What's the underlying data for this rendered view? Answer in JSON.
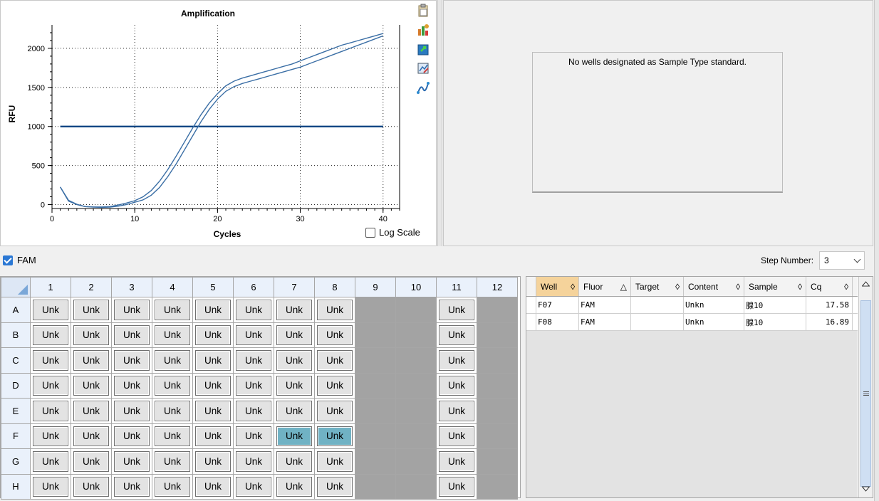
{
  "chart": {
    "title": "Amplification",
    "xlabel": "Cycles",
    "ylabel": "RFU",
    "log_scale_label": "Log Scale",
    "log_scale_checked": false
  },
  "chart_data": {
    "type": "line",
    "title": "Amplification",
    "xlabel": "Cycles",
    "ylabel": "RFU",
    "xlim": [
      0,
      42
    ],
    "ylim": [
      -50,
      2300
    ],
    "xticks": [
      0,
      10,
      20,
      30,
      40
    ],
    "yticks": [
      0,
      500,
      1000,
      1500,
      2000
    ],
    "grid": true,
    "threshold": 1000,
    "threshold_color": "#003f7f",
    "series_color": "#3a6ea5",
    "x": [
      1,
      2,
      3,
      4,
      5,
      6,
      7,
      8,
      9,
      10,
      11,
      12,
      13,
      14,
      15,
      16,
      17,
      18,
      19,
      20,
      21,
      22,
      23,
      24,
      25,
      26,
      27,
      28,
      29,
      30,
      31,
      32,
      33,
      34,
      35,
      36,
      37,
      38,
      39,
      40
    ],
    "series": [
      {
        "values": [
          225,
          55,
          5,
          -25,
          -30,
          -30,
          -25,
          -5,
          20,
          50,
          100,
          180,
          300,
          450,
          620,
          800,
          980,
          1150,
          1300,
          1420,
          1520,
          1580,
          1620,
          1650,
          1680,
          1710,
          1740,
          1770,
          1800,
          1840,
          1880,
          1920,
          1960,
          2000,
          2040,
          2070,
          2100,
          2130,
          2160,
          2190
        ]
      },
      {
        "values": [
          225,
          45,
          0,
          -25,
          -32,
          -35,
          -32,
          -20,
          0,
          30,
          60,
          120,
          220,
          360,
          520,
          700,
          880,
          1060,
          1220,
          1350,
          1450,
          1510,
          1550,
          1580,
          1610,
          1640,
          1670,
          1700,
          1730,
          1760,
          1800,
          1840,
          1880,
          1920,
          1960,
          2000,
          2040,
          2080,
          2120,
          2160
        ]
      }
    ]
  },
  "icons": [
    "clipboard-icon",
    "export-chart-icon",
    "export-data-icon",
    "chart-tools-icon",
    "trace-icon"
  ],
  "standard_message": "No wells designated as Sample Type standard.",
  "fluor_checkbox": {
    "label": "FAM",
    "checked": true
  },
  "step": {
    "label": "Step Number:",
    "value": "3"
  },
  "plate": {
    "columns": [
      "1",
      "2",
      "3",
      "4",
      "5",
      "6",
      "7",
      "8",
      "9",
      "10",
      "11",
      "12"
    ],
    "rows": [
      "A",
      "B",
      "C",
      "D",
      "E",
      "F",
      "G",
      "H"
    ],
    "well_label": "Unk",
    "empty_columns": [
      "9",
      "10",
      "12"
    ],
    "selected_wells": [
      "F7",
      "F8"
    ]
  },
  "results": {
    "headers": [
      "Well",
      "Fluor",
      "Target",
      "Content",
      "Sample",
      "Cq"
    ],
    "sorted_column": "Well",
    "rows": [
      {
        "well": "F07",
        "fluor": "FAM",
        "target": "",
        "content": "Unkn",
        "sample": "腺10",
        "cq": "17.58"
      },
      {
        "well": "F08",
        "fluor": "FAM",
        "target": "",
        "content": "Unkn",
        "sample": "腺10",
        "cq": "16.89"
      }
    ]
  }
}
